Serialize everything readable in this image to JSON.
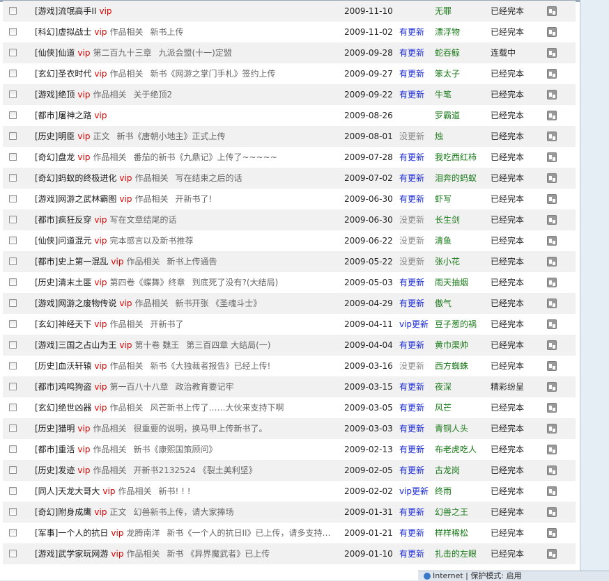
{
  "rows": [
    {
      "category": "[游戏]",
      "name": "流氓高手II",
      "vip": "vip",
      "section": "",
      "chapter": "",
      "date": "2009-11-10",
      "status": "",
      "status_type": "none",
      "author": "无罪",
      "state": "已经完本"
    },
    {
      "category": "[科幻]",
      "name": "虚拟战士",
      "vip": "vip",
      "section": "作品相关",
      "chapter": "新书上传",
      "date": "2009-11-02",
      "status": "有更新",
      "status_type": "has",
      "author": "漂浮物",
      "state": "已经完本"
    },
    {
      "category": "[仙侠]",
      "name": "仙道",
      "vip": "vip",
      "section": "第二百九十三章",
      "chapter": "九派会盟(十一)定盟",
      "date": "2009-09-28",
      "status": "有更新",
      "status_type": "has",
      "author": "蛇吞鲸",
      "state": "连载中"
    },
    {
      "category": "[玄幻]",
      "name": "圣衣时代",
      "vip": "vip",
      "section": "作品相关",
      "chapter": "新书《网游之掌门手札》签约上传",
      "date": "2009-09-27",
      "status": "有更新",
      "status_type": "has",
      "author": "笨太子",
      "state": "已经完本"
    },
    {
      "category": "[游戏]",
      "name": "绝顶",
      "vip": "vip",
      "section": "作品相关",
      "chapter": "关于绝顶2",
      "date": "2009-09-22",
      "status": "有更新",
      "status_type": "has",
      "author": "牛笔",
      "state": "已经完本"
    },
    {
      "category": "[都市]",
      "name": "屠神之路",
      "vip": "vip",
      "section": "",
      "chapter": "",
      "date": "2009-08-26",
      "status": "",
      "status_type": "none",
      "author": "罗霸道",
      "state": "已经完本"
    },
    {
      "category": "[历史]",
      "name": "明臣",
      "vip": "vip",
      "section": "正文",
      "chapter": "新书《唐朝小地主》正式上传",
      "date": "2009-08-01",
      "status": "没更新",
      "status_type": "none",
      "author": "烛",
      "state": "已经完本"
    },
    {
      "category": "[奇幻]",
      "name": "盘龙",
      "vip": "vip",
      "section": "作品相关",
      "chapter": "番茄的新书《九鼎记》上传了~~~~~",
      "date": "2009-07-28",
      "status": "有更新",
      "status_type": "has",
      "author": "我吃西红柿",
      "state": "已经完本"
    },
    {
      "category": "[奇幻]",
      "name": "蚂蚁的终极进化",
      "vip": "vip",
      "section": "作品相关",
      "chapter": "写在结束之后的话",
      "date": "2009-07-02",
      "status": "有更新",
      "status_type": "has",
      "author": "泪奔的蚂蚁",
      "state": "已经完本"
    },
    {
      "category": "[游戏]",
      "name": "网游之武林霸图",
      "vip": "vip",
      "section": "作品相关",
      "chapter": "开新书了!",
      "date": "2009-06-30",
      "status": "有更新",
      "status_type": "has",
      "author": "虾写",
      "state": "已经完本"
    },
    {
      "category": "[都市]",
      "name": "疯狂反穿",
      "vip": "vip",
      "section": "写在文章结尾的话",
      "chapter": "",
      "date": "2009-06-30",
      "status": "没更新",
      "status_type": "none",
      "author": "长生剑",
      "state": "已经完本"
    },
    {
      "category": "[仙侠]",
      "name": "问道混元",
      "vip": "vip",
      "section": "完本感言以及新书推荐",
      "chapter": "",
      "date": "2009-06-22",
      "status": "没更新",
      "status_type": "none",
      "author": "清鱼",
      "state": "已经完本"
    },
    {
      "category": "[都市]",
      "name": "史上第一混乱",
      "vip": "vip",
      "section": "作品相关",
      "chapter": "新书上传通告",
      "date": "2009-05-22",
      "status": "没更新",
      "status_type": "none",
      "author": "张小花",
      "state": "已经完本"
    },
    {
      "category": "[历史]",
      "name": "清末土匪",
      "vip": "vip",
      "section": "第四卷《蝶舞》终章",
      "chapter": "到底死了没有?(大结局)",
      "date": "2009-05-03",
      "status": "有更新",
      "status_type": "has",
      "author": "雨天抽烟",
      "state": "已经完本"
    },
    {
      "category": "[游戏]",
      "name": "网游之废物传说",
      "vip": "vip",
      "section": "作品相关",
      "chapter": "新书开张 《圣魂斗士》",
      "date": "2009-04-29",
      "status": "有更新",
      "status_type": "has",
      "author": "傲气",
      "state": "已经完本"
    },
    {
      "category": "[玄幻]",
      "name": "神经天下",
      "vip": "vip",
      "section": "作品相关",
      "chapter": "开新书了",
      "date": "2009-04-11",
      "status": "vip更新",
      "status_type": "has",
      "author": "豆子葱的祸",
      "state": "已经完本"
    },
    {
      "category": "[游戏]",
      "name": "三国之占山为王",
      "vip": "vip",
      "section": "第十卷 魏王",
      "chapter": "第三百四章 大结局(一)",
      "date": "2009-04-04",
      "status": "有更新",
      "status_type": "has",
      "author": "黄巾渠帅",
      "state": "已经完本"
    },
    {
      "category": "[历史]",
      "name": "血沃轩辕",
      "vip": "vip",
      "section": "作品相关",
      "chapter": "新书《大独裁者报告》已经上传!",
      "date": "2009-03-16",
      "status": "没更新",
      "status_type": "none",
      "author": "西方蜘蛛",
      "state": "已经完本"
    },
    {
      "category": "[都市]",
      "name": "鸡鸣狗盗",
      "vip": "vip",
      "section": "第一百八十八章",
      "chapter": "政治教育要记牢",
      "date": "2009-03-15",
      "status": "有更新",
      "status_type": "has",
      "author": "夜深",
      "state": "精彩纷呈"
    },
    {
      "category": "[玄幻]",
      "name": "绝世凶器",
      "vip": "vip",
      "section": "作品相关",
      "chapter": "风芒新书上传了……大伙来支持下啊",
      "date": "2009-03-05",
      "status": "有更新",
      "status_type": "has",
      "author": "风芒",
      "state": "已经完本"
    },
    {
      "category": "[历史]",
      "name": "猎明",
      "vip": "vip",
      "section": "作品相关",
      "chapter": "很重要的说明，换马甲上传新书了。",
      "date": "2009-03-03",
      "status": "有更新",
      "status_type": "has",
      "author": "青铜人头",
      "state": "已经完本"
    },
    {
      "category": "[都市]",
      "name": "重活",
      "vip": "vip",
      "section": "作品相关",
      "chapter": "新书《康熙国策顾问》",
      "date": "2009-02-13",
      "status": "有更新",
      "status_type": "has",
      "author": "布老虎吃人",
      "state": "已经完本"
    },
    {
      "category": "[历史]",
      "name": "发迹",
      "vip": "vip",
      "section": "作品相关",
      "chapter": "开新书2132524 《裂土美利坚》",
      "date": "2009-02-05",
      "status": "有更新",
      "status_type": "has",
      "author": "古龙岗",
      "state": "已经完本"
    },
    {
      "category": "[同人]",
      "name": "天龙大哥大",
      "vip": "vip",
      "section": "作品相关",
      "chapter": "新书! ! !",
      "date": "2009-02-02",
      "status": "vip更新",
      "status_type": "has",
      "author": "终雨",
      "state": "已经完本"
    },
    {
      "category": "[奇幻]",
      "name": "附身成鹰",
      "vip": "vip",
      "section": "正文",
      "chapter": "幻兽新书上传，请大家捧场",
      "date": "2009-01-31",
      "status": "有更新",
      "status_type": "has",
      "author": "幻兽之王",
      "state": "已经完本"
    },
    {
      "category": "[军事]",
      "name": "一个人的抗日",
      "vip": "vip",
      "section": "龙腾南洋",
      "chapter": "新书《一个人的抗日II》已上传，请多支持…",
      "date": "2009-01-21",
      "status": "有更新",
      "status_type": "has",
      "author": "样样稀松",
      "state": "已经完本"
    },
    {
      "category": "[游戏]",
      "name": "武学家玩网游",
      "vip": "vip",
      "section": "作品相关",
      "chapter": "新书 《异界魔武者》已上传",
      "date": "2009-01-10",
      "status": "有更新",
      "status_type": "has",
      "author": "扎击的左眼",
      "state": "已经完本"
    }
  ],
  "statusbar": {
    "zone": "Internet | 保护模式: 启用"
  }
}
